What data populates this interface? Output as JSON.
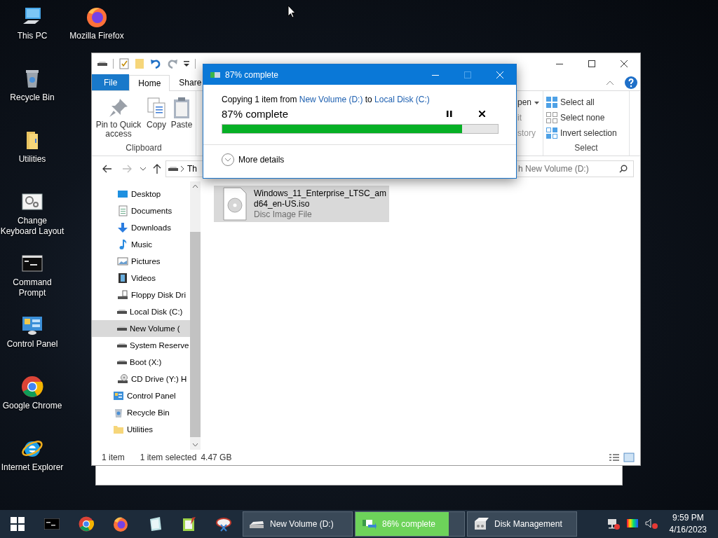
{
  "desktop_icons": [
    {
      "label": "This PC",
      "kind": "pc"
    },
    {
      "label": "Recycle Bin",
      "kind": "bin"
    },
    {
      "label": "Utilities",
      "kind": "folder"
    },
    {
      "label": "Change Keyboard Layout",
      "kind": "keyboard"
    },
    {
      "label": "Command Prompt",
      "kind": "cmd"
    },
    {
      "label": "Control Panel",
      "kind": "control"
    },
    {
      "label": "Google Chrome",
      "kind": "chrome"
    },
    {
      "label": "Internet Explorer",
      "kind": "ie"
    },
    {
      "label": "Mozilla Firefox",
      "kind": "firefox"
    }
  ],
  "explorer": {
    "ribbon_tabs": [
      {
        "label": "File",
        "selected": false,
        "kind": "file"
      },
      {
        "label": "Home",
        "selected": true,
        "kind": "tab"
      },
      {
        "label": "Share",
        "selected": false,
        "kind": "tab"
      }
    ],
    "clipboard": {
      "buttons": [
        {
          "label": "Pin to Quick access",
          "kind": "pin"
        },
        {
          "label": "Copy",
          "kind": "copy"
        },
        {
          "label": "Paste",
          "kind": "paste"
        }
      ],
      "group": "Clipboard"
    },
    "open_group": {
      "buttons": [
        "pen",
        "it",
        "story"
      ]
    },
    "select_group": {
      "buttons": [
        {
          "label": "Select all",
          "kind": "all"
        },
        {
          "label": "Select none",
          "kind": "none"
        },
        {
          "label": "Invert selection",
          "kind": "invert"
        }
      ],
      "group": "Select"
    },
    "address": "Th",
    "search": {
      "placeholder": "h New Volume (D:)"
    },
    "nav_pc_items": [
      {
        "label": "Desktop",
        "kind": "desktop",
        "selected": false
      },
      {
        "label": "Documents",
        "kind": "documents",
        "selected": false
      },
      {
        "label": "Downloads",
        "kind": "downloads",
        "selected": false
      },
      {
        "label": "Music",
        "kind": "music",
        "selected": false
      },
      {
        "label": "Pictures",
        "kind": "pictures",
        "selected": false
      },
      {
        "label": "Videos",
        "kind": "videos",
        "selected": false
      },
      {
        "label": "Floppy Disk Dri",
        "kind": "floppy",
        "selected": false
      },
      {
        "label": "Local Disk (C:)",
        "kind": "drive",
        "selected": false
      },
      {
        "label": "New Volume (",
        "kind": "drive",
        "selected": true
      },
      {
        "label": "System Reserve",
        "kind": "drive",
        "selected": false
      },
      {
        "label": "Boot (X:)",
        "kind": "drive",
        "selected": false
      },
      {
        "label": "CD Drive (Y:) H",
        "kind": "cd",
        "selected": false
      }
    ],
    "nav_items": [
      {
        "label": "Control Panel",
        "kind": "control",
        "selected": false
      },
      {
        "label": "Recycle Bin",
        "kind": "recycle",
        "selected": false
      },
      {
        "label": "Utilities",
        "kind": "folder",
        "selected": false
      }
    ],
    "files": [
      {
        "name": "Windows_11_Enterprise_LTSC_amd64_en-US.iso",
        "type": "Disc Image File",
        "selected": true
      }
    ],
    "status": {
      "count": "1 item",
      "selection": "1 item selected",
      "size": "4.47 GB"
    }
  },
  "copy_dialog": {
    "title": "87% complete",
    "message": [
      {
        "kind": "text",
        "text": "Copying 1 item from "
      },
      {
        "kind": "link",
        "text": "New Volume (D:)"
      },
      {
        "kind": "text",
        "text": " to "
      },
      {
        "kind": "link",
        "text": "Local Disk (C:)"
      }
    ],
    "status": "87% complete",
    "level": 0.87,
    "details": "More details"
  },
  "taskbar": {
    "tasks": [
      {
        "label": "New Volume (D:)",
        "kind": "explorer"
      },
      {
        "label": "86% complete",
        "kind": "copy",
        "level": 0.86
      },
      {
        "label": "Disk Management",
        "kind": "disk"
      }
    ],
    "time": "9:59 PM",
    "date": "4/16/2023"
  }
}
